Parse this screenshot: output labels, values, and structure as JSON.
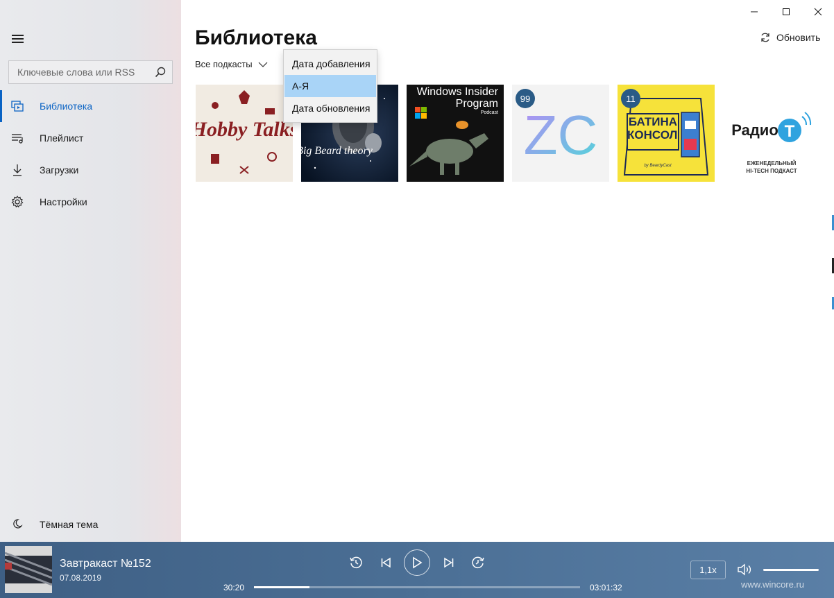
{
  "app": {
    "page_title": "Библиотека",
    "accent_color": "#0a63c4"
  },
  "search": {
    "placeholder": "Ключевые слова или RSS"
  },
  "sidebar": {
    "items": [
      {
        "label": "Библиотека",
        "icon": "library-icon",
        "active": true
      },
      {
        "label": "Плейлист",
        "icon": "playlist-icon",
        "active": false
      },
      {
        "label": "Загрузки",
        "icon": "download-icon",
        "active": false
      },
      {
        "label": "Настройки",
        "icon": "gear-icon",
        "active": false
      }
    ],
    "theme_label": "Тёмная тема"
  },
  "toolbar": {
    "filter_label": "Все подкасты",
    "refresh_label": "Обновить"
  },
  "sort_menu": {
    "options": [
      "Дата добавления",
      "А-Я",
      "Дата обновления"
    ],
    "selected": "А-Я"
  },
  "podcasts": [
    {
      "name": "Hobby Talks",
      "badge": ""
    },
    {
      "name": "Big Beard theory",
      "badge": ""
    },
    {
      "name": "Windows Insider Program",
      "subtitle": "Podcast",
      "badge": ""
    },
    {
      "name": "ZC",
      "badge": "99"
    },
    {
      "name": "БАТИНА КОНСОЛЬ",
      "credit": "by BeardyCast",
      "badge": "11"
    },
    {
      "name": "Радио",
      "logo_letter": "T",
      "tagline_1": "ЕЖЕНЕДЕЛЬНЫЙ",
      "tagline_2": "HI-TECH ПОДКАСТ",
      "badge": ""
    }
  ],
  "player": {
    "episode_title": "Завтракаст №152",
    "episode_date": "07.08.2019",
    "time_current": "30:20",
    "time_total": "03:01:32",
    "progress_fraction": 0.17,
    "speed": "1,1x",
    "watermark": "www.wincore.ru"
  }
}
